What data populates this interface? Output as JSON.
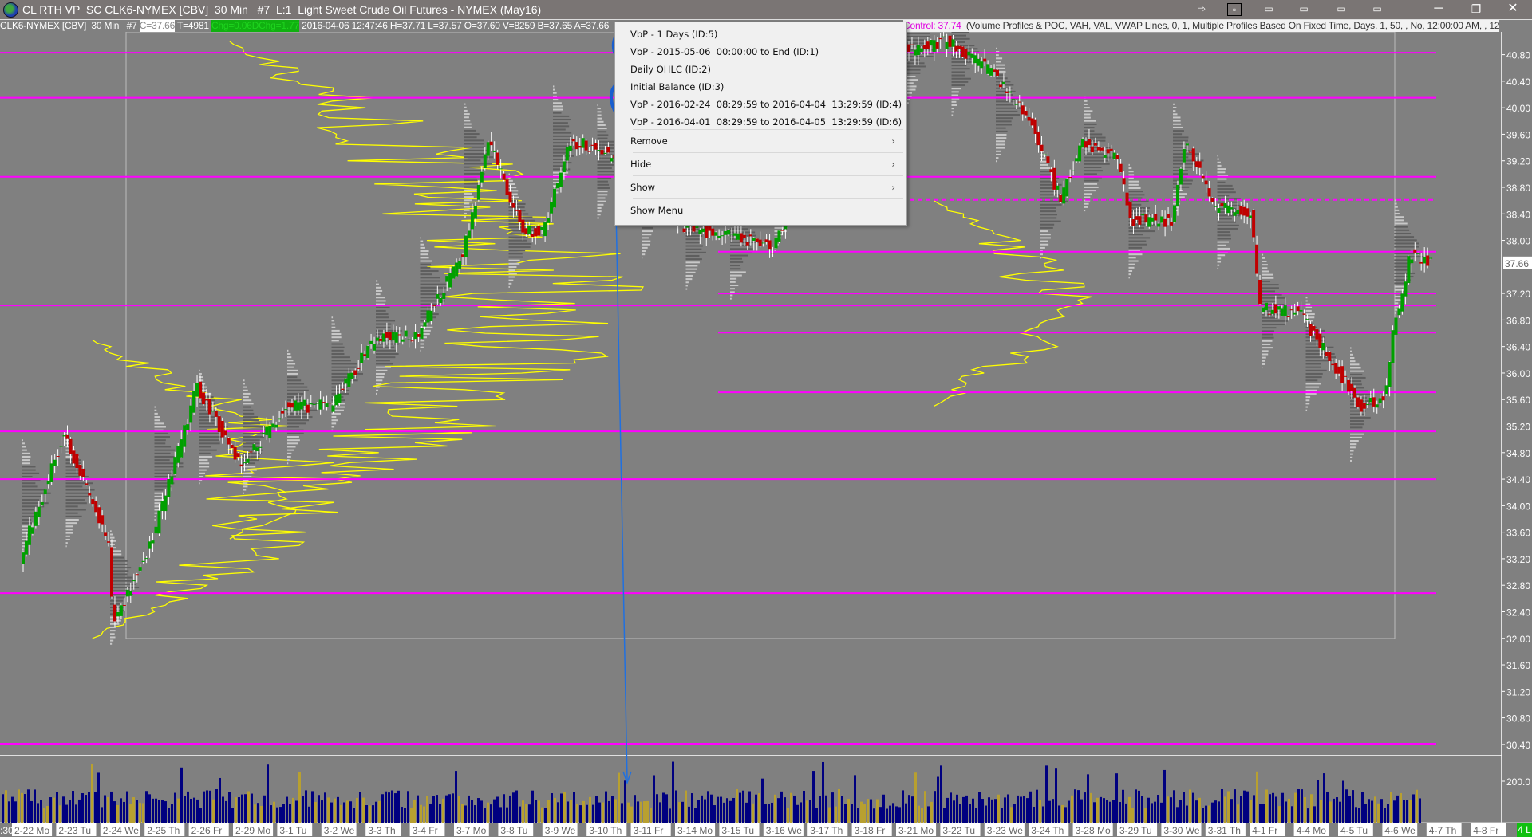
{
  "window": {
    "title": "CL RTH VP  SC CLK6-NYMEX [CBV]  30 Min   #7  L:1  Light Sweet Crude Oil Futures - NYMEX (May16)",
    "buttons": [
      "attach-icon",
      "pin-icon",
      "tile-1-icon",
      "tile-2-icon",
      "tile-3-icon",
      "tile-4-icon",
      "minimize-icon",
      "restore-icon",
      "close-icon"
    ]
  },
  "infobar": {
    "symbol": "CLK6-NYMEX [CBV]  30 Min   #7 ",
    "close": "C=37.66",
    "trades": " T=4981 ",
    "chg": "Chg=0.06",
    "dchg": "DChg=1.77",
    "details": " 2016-04-06 12:47:46 H=37.71 L=37.57 O=37.60 V=8259 B=37.65 A=37.66",
    "control": "Control: 37.74",
    "study": "  (Volume Profiles & POC, VAH, VAL, VWAP Lines, 0, 1, Multiple Profiles Based On Fixed Time, Days, 1, 50, , No, 12:00:00 AM, , 12"
  },
  "context_menu": {
    "studies": [
      "VbP - 1 Days (ID:5)",
      "VbP - 2015-05-06  00:00:00 to End (ID:1)",
      "Daily OHLC (ID:2)",
      "Initial Balance (ID:3)",
      "VbP - 2016-02-24  08:29:59 to 2016-04-04  13:29:59 (ID:4)",
      "VbP - 2016-04-01  08:29:59 to 2016-04-05  13:29:59 (ID:6)"
    ],
    "actions": [
      {
        "label": "Remove",
        "submenu": true
      },
      {
        "label": "Hide",
        "submenu": true
      },
      {
        "label": "Show",
        "submenu": true
      },
      {
        "label": "Show Menu",
        "submenu": false
      }
    ]
  },
  "bottom_badge": "4 L",
  "chart_data": {
    "type": "candlestick",
    "instrument": "CLK6-NYMEX",
    "interval": "30 Min",
    "last_price": "37.66",
    "price_ticks": [
      "40.80",
      "40.40",
      "40.00",
      "39.60",
      "39.20",
      "38.80",
      "38.40",
      "38.00",
      "37.20",
      "36.80",
      "36.40",
      "36.00",
      "35.60",
      "35.20",
      "34.80",
      "34.40",
      "34.00",
      "33.60",
      "33.20",
      "32.80",
      "32.40",
      "32.00",
      "31.60",
      "31.20",
      "30.80",
      "30.40"
    ],
    "ylim": [
      30.4,
      40.8
    ],
    "volume_tick": "200.0",
    "x_partial_label": ":30",
    "date_labels": [
      "2-22 Mo",
      "2-23 Tu",
      "2-24 We",
      "2-25 Th",
      "2-26 Fr",
      "2-29 Mo",
      "3-1 Tu",
      "3-2 We",
      "3-3 Th",
      "3-4 Fr",
      "3-7 Mo",
      "3-8 Tu",
      "3-9 We",
      "3-10 Th",
      "3-11 Fr",
      "3-14 Mo",
      "3-15 Tu",
      "3-16 We",
      "3-17 Th",
      "3-18 Fr",
      "3-21 Mo",
      "3-22 Tu",
      "3-23 We",
      "3-24 Th",
      "3-28 Mo",
      "3-29 Tu",
      "3-30 We",
      "3-31 Th",
      "4-1 Fr",
      "4-4 Mo",
      "4-5 Tu",
      "4-6 We",
      "4-7 Th",
      "4-8 Fr"
    ],
    "price_path": [
      [
        0,
        33.2
      ],
      [
        1,
        35.1
      ],
      [
        2,
        33.4
      ],
      [
        2.1,
        32.2
      ],
      [
        3,
        33.5
      ],
      [
        4,
        35.8
      ],
      [
        5,
        34.6
      ],
      [
        6,
        35.5
      ],
      [
        7,
        35.5
      ],
      [
        8,
        36.5
      ],
      [
        9,
        36.6
      ],
      [
        10,
        37.8
      ],
      [
        10.6,
        39.5
      ],
      [
        11.3,
        38.2
      ],
      [
        11.8,
        38.1
      ],
      [
        12.4,
        39.5
      ],
      [
        13,
        39.4
      ],
      [
        14,
        39.0
      ],
      [
        15,
        38.2
      ],
      [
        16.4,
        38.0
      ],
      [
        17,
        37.9
      ],
      [
        18,
        39.5
      ],
      [
        19.5,
        40.8
      ],
      [
        21,
        41.0
      ],
      [
        22,
        40.5
      ],
      [
        22.9,
        39.7
      ],
      [
        23.5,
        38.6
      ],
      [
        24,
        39.5
      ],
      [
        24.8,
        39.2
      ],
      [
        25.1,
        38.3
      ],
      [
        26,
        38.3
      ],
      [
        26.3,
        39.5
      ],
      [
        27,
        38.5
      ],
      [
        27.8,
        38.4
      ],
      [
        28,
        37.0
      ],
      [
        28.9,
        36.9
      ],
      [
        29.8,
        36.0
      ],
      [
        30.3,
        35.5
      ],
      [
        30.8,
        35.6
      ],
      [
        31,
        36.6
      ],
      [
        31.4,
        37.8
      ],
      [
        31.8,
        37.66
      ]
    ],
    "magenta_levels": [
      40.83,
      40.15,
      38.96,
      37.02,
      35.12,
      34.4,
      32.68,
      30.41
    ],
    "magenta_levels_right": [
      38.61,
      37.83,
      37.2,
      36.61,
      35.71
    ],
    "colors": {
      "up": "#00a000",
      "down": "#c00000",
      "poc": "#ff00ff",
      "profile": "#ffff00",
      "volume": "#000080",
      "background": "#808080"
    }
  }
}
